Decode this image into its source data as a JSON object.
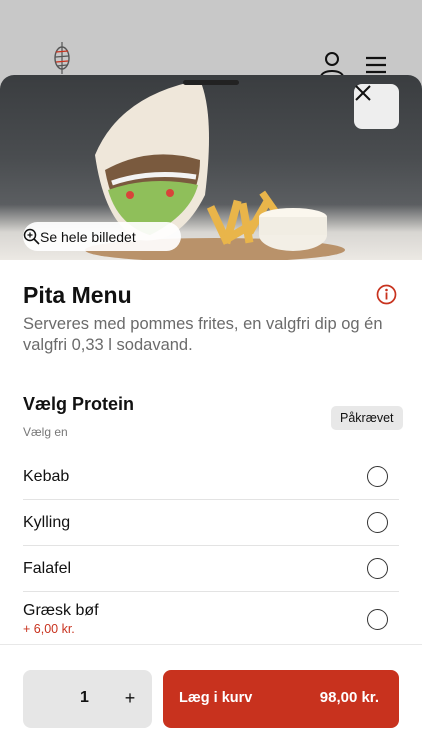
{
  "background_header": {
    "icons": [
      "doner-logo-icon",
      "user-icon",
      "menu-icon"
    ]
  },
  "hero": {
    "see_all_label": "Se hele billedet"
  },
  "product": {
    "title": "Pita Menu",
    "description": "Serveres med pommes frites, en valgfri dip og én valgfri 0,33 l sodavand."
  },
  "section": {
    "title": "Vælg Protein",
    "subtitle": "Vælg en",
    "required_label": "Påkrævet",
    "options": [
      {
        "name": "Kebab",
        "price": ""
      },
      {
        "name": "Kylling",
        "price": ""
      },
      {
        "name": "Falafel",
        "price": ""
      },
      {
        "name": "Græsk bøf",
        "price": "+ 6,00 kr."
      }
    ]
  },
  "footer": {
    "quantity": "1",
    "plus": "+",
    "add_to_cart_label": "Læg i kurv",
    "total_price": "98,00 kr."
  },
  "colors": {
    "accent": "#c8321e",
    "muted_text": "#6b6b6b"
  }
}
